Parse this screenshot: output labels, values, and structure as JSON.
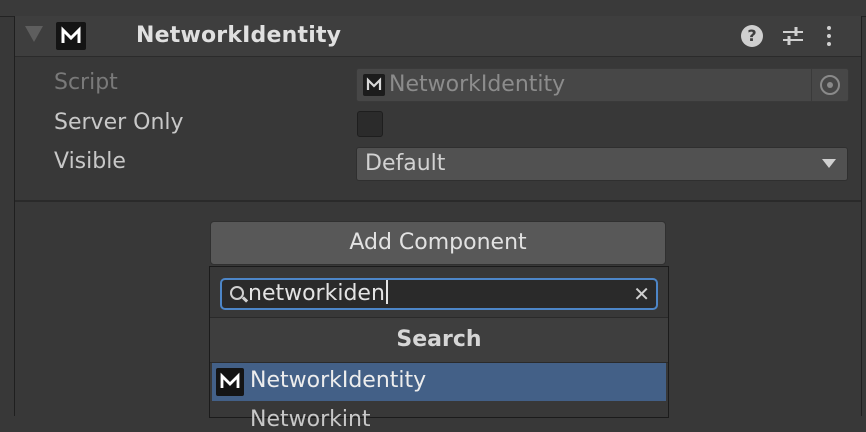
{
  "component": {
    "title": "NetworkIdentity",
    "help_glyph": "?",
    "icons": [
      "foldout-arrow-icon",
      "mirror-logo-icon",
      "help-icon",
      "preset-icon",
      "kebab-menu-icon"
    ]
  },
  "fields": {
    "script": {
      "label": "Script",
      "value": "NetworkIdentity"
    },
    "server_only": {
      "label": "Server Only",
      "checked": false
    },
    "visible": {
      "label": "Visible",
      "value": "Default"
    }
  },
  "add_component": {
    "button_label": "Add Component",
    "search_value": "networkiden",
    "clear_glyph": "✕",
    "section_title": "Search",
    "results": [
      {
        "label": "NetworkIdentity",
        "selected": true
      },
      {
        "label": "Networkint",
        "selected": false
      }
    ]
  },
  "colors": {
    "selection": "#436087",
    "focus_ring": "#4d86c8"
  }
}
